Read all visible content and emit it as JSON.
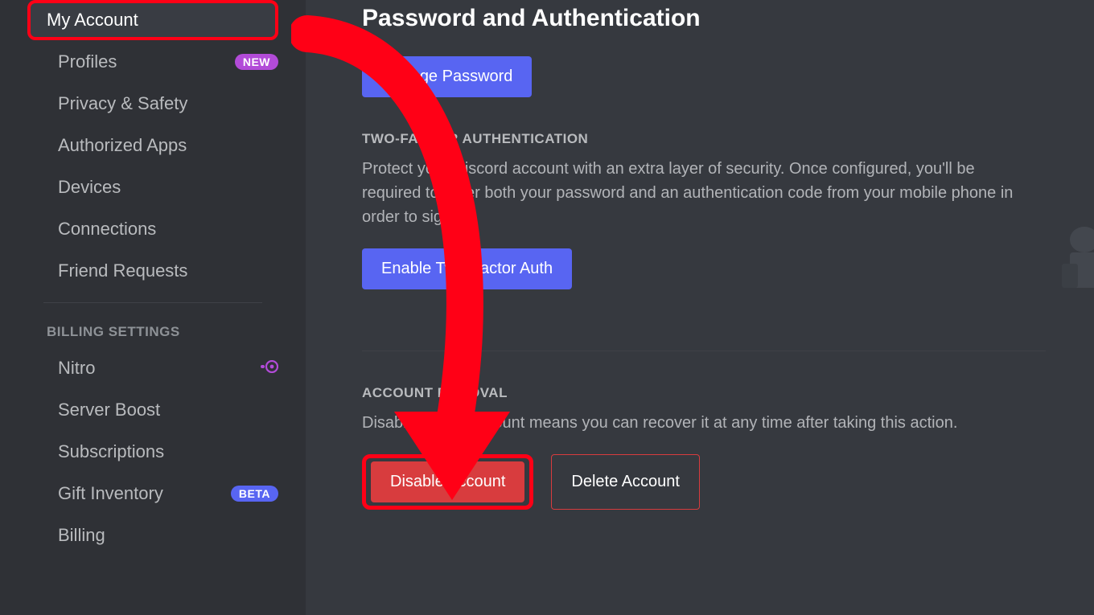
{
  "sidebar": {
    "items": [
      {
        "label": "My Account",
        "active": true
      },
      {
        "label": "Profiles",
        "badge": "NEW",
        "badgeClass": "badge-new"
      },
      {
        "label": "Privacy & Safety"
      },
      {
        "label": "Authorized Apps"
      },
      {
        "label": "Devices"
      },
      {
        "label": "Connections"
      },
      {
        "label": "Friend Requests"
      }
    ],
    "billingHeader": "BILLING SETTINGS",
    "billingItems": [
      {
        "label": "Nitro",
        "icon": "nitro"
      },
      {
        "label": "Server Boost"
      },
      {
        "label": "Subscriptions"
      },
      {
        "label": "Gift Inventory",
        "badge": "BETA",
        "badgeClass": "badge-beta"
      },
      {
        "label": "Billing"
      }
    ]
  },
  "main": {
    "title": "Password and Authentication",
    "changePassword": "Change Password",
    "twoFactorHeader": "TWO-FACTOR AUTHENTICATION",
    "twoFactorDesc": "Protect your Discord account with an extra layer of security. Once configured, you'll be required to enter both your password and an authentication code from your mobile phone in order to sign in.",
    "enable2fa": "Enable Two-Factor Auth",
    "removalHeader": "ACCOUNT REMOVAL",
    "removalDesc": "Disabling your account means you can recover it at any time after taking this action.",
    "disableAccount": "Disable Account",
    "deleteAccount": "Delete Account"
  },
  "annotations": {
    "arrowColor": "#ff0016",
    "highlightColor": "#ff0016"
  }
}
